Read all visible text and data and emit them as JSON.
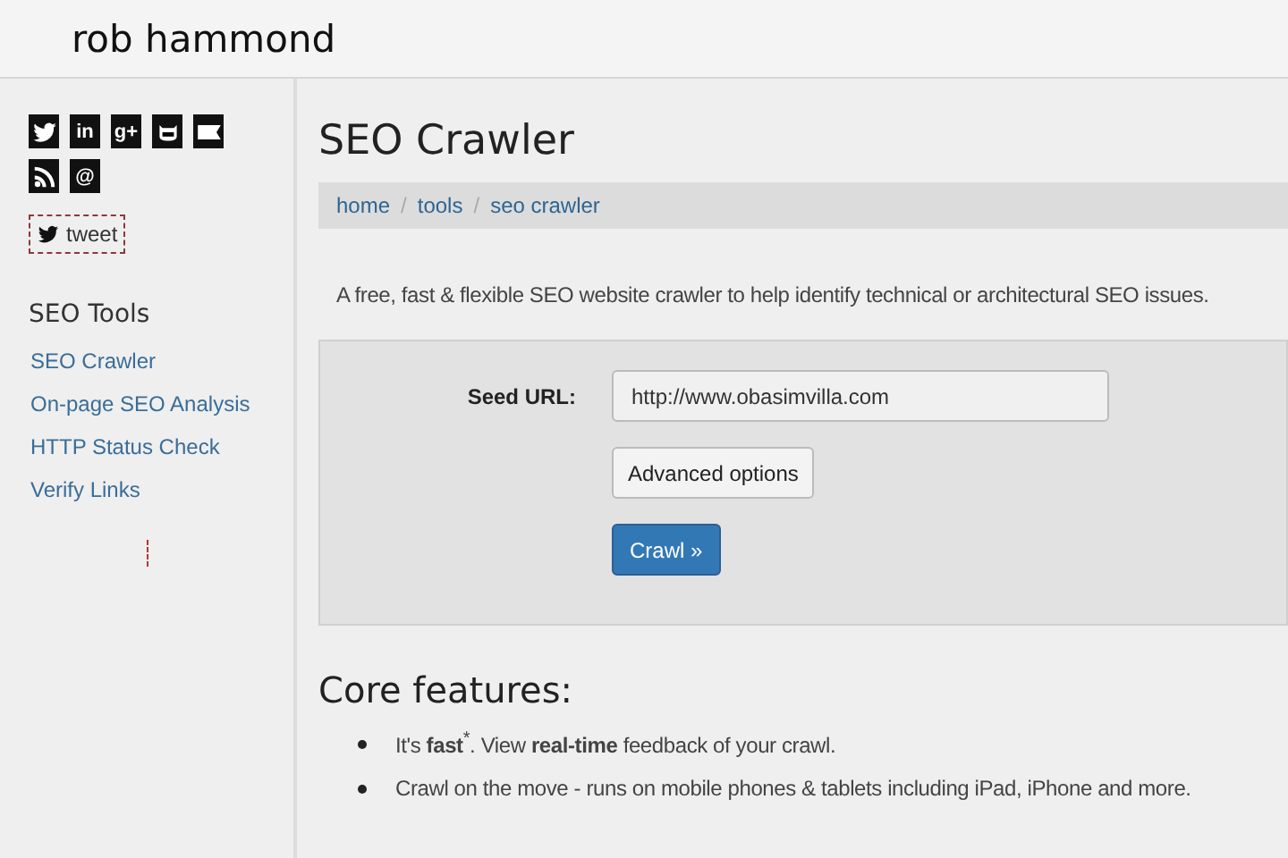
{
  "header": {
    "title": "rob hammond"
  },
  "sidebar": {
    "social_icons": [
      {
        "kind": "bird"
      },
      {
        "kind": "glyph",
        "glyph": "in"
      },
      {
        "kind": "glyph",
        "glyph": "g+"
      },
      {
        "kind": "cat"
      },
      {
        "kind": "flag"
      },
      {
        "kind": "rss"
      },
      {
        "kind": "glyph",
        "glyph": "@"
      }
    ],
    "tweet_button": "tweet",
    "section_title": "SEO Tools",
    "links": [
      "SEO Crawler",
      "On-page SEO Analysis",
      "HTTP Status Check",
      "Verify Links"
    ]
  },
  "page": {
    "title": "SEO Crawler",
    "breadcrumb": [
      "home",
      "tools",
      "seo crawler"
    ],
    "breadcrumb_separator": "/",
    "description": "A free, fast & flexible SEO website crawler to help identify technical or architectural SEO issues.",
    "form": {
      "seed_label": "Seed URL:",
      "seed_value": "http://www.obasimvilla.com",
      "advanced_button": "Advanced options",
      "crawl_button": "Crawl »"
    },
    "features_title": "Core features:",
    "features": [
      "It's **fast**$^{*}$. View **real-time** feedback of your crawl.",
      "Crawl on the move - runs on mobile phones & tablets including iPad, iPhone and more."
    ]
  }
}
